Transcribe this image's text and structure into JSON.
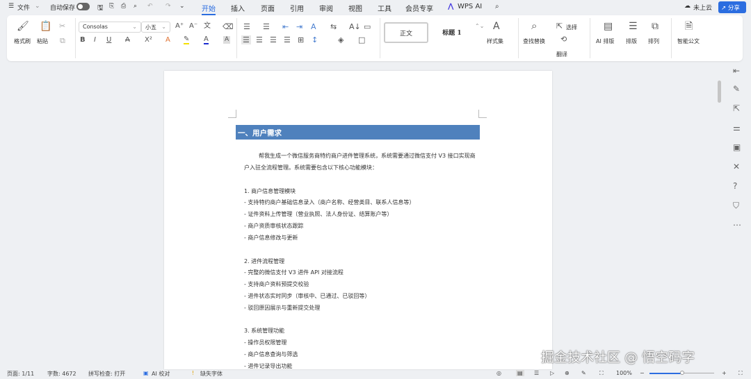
{
  "titlebar": {
    "menu_icon": "menu-icon",
    "file": "文件",
    "autosave": "自动保存",
    "tabs": [
      "开始",
      "插入",
      "页面",
      "引用",
      "审阅",
      "视图",
      "工具",
      "会员专享",
      "WPS AI"
    ],
    "active_tab": "开始",
    "cloud": "未上云",
    "share": "分享"
  },
  "ribbon": {
    "format_painter": "格式刷",
    "paste": "粘贴",
    "font_name": "Consolas",
    "font_size": "小五",
    "style_normal": "正文",
    "style_heading": "标题 1",
    "style_set": "样式集",
    "find_replace": "查找替换",
    "select": "选择",
    "translate": "翻译",
    "ai_layout": "AI 排版",
    "layout": "排版",
    "arrange": "排列",
    "smart_doc": "智能公文"
  },
  "document": {
    "heading": "一、用户需求",
    "lines": [
      "帮我生成一个微信服务商特约商户进件管理系统，系统需要通过微信支付 V3 接口实现商",
      "户入驻全流程管理。系统需要包含以下核心功能模块：",
      "1. 商户信息管理模块",
      "- 支持特约商户基础信息录入（商户名称、经营类目、联系人信息等）",
      "- 证件资料上传管理（营业执照、法人身份证、结算账户等）",
      "- 商户资质审核状态跟踪",
      "- 商户信息修改与更新",
      "2. 进件流程管理",
      "- 完整的微信支付 V3 进件 API 对接流程",
      "- 支持商户资料预提交校验",
      "- 进件状态实时同步（审核中、已通过、已驳回等）",
      "- 驳回原因展示与重新提交处理",
      "3. 系统管理功能",
      "- 操作员权限管理",
      "- 商户信息查询与筛选",
      "- 进件记录导出功能"
    ]
  },
  "status": {
    "page": "页面: 1/11",
    "words": "字数: 4672",
    "spell": "拼写检查: 打开",
    "ai_check": "AI 校对",
    "missing_font": "缺失字体",
    "zoom": "100%",
    "zoom_level": 0.5
  },
  "watermark": "掘金技术社区 @ 悟空码字",
  "colors": {
    "accent": "#2b6de0",
    "heading_bg": "#4f81bd"
  }
}
